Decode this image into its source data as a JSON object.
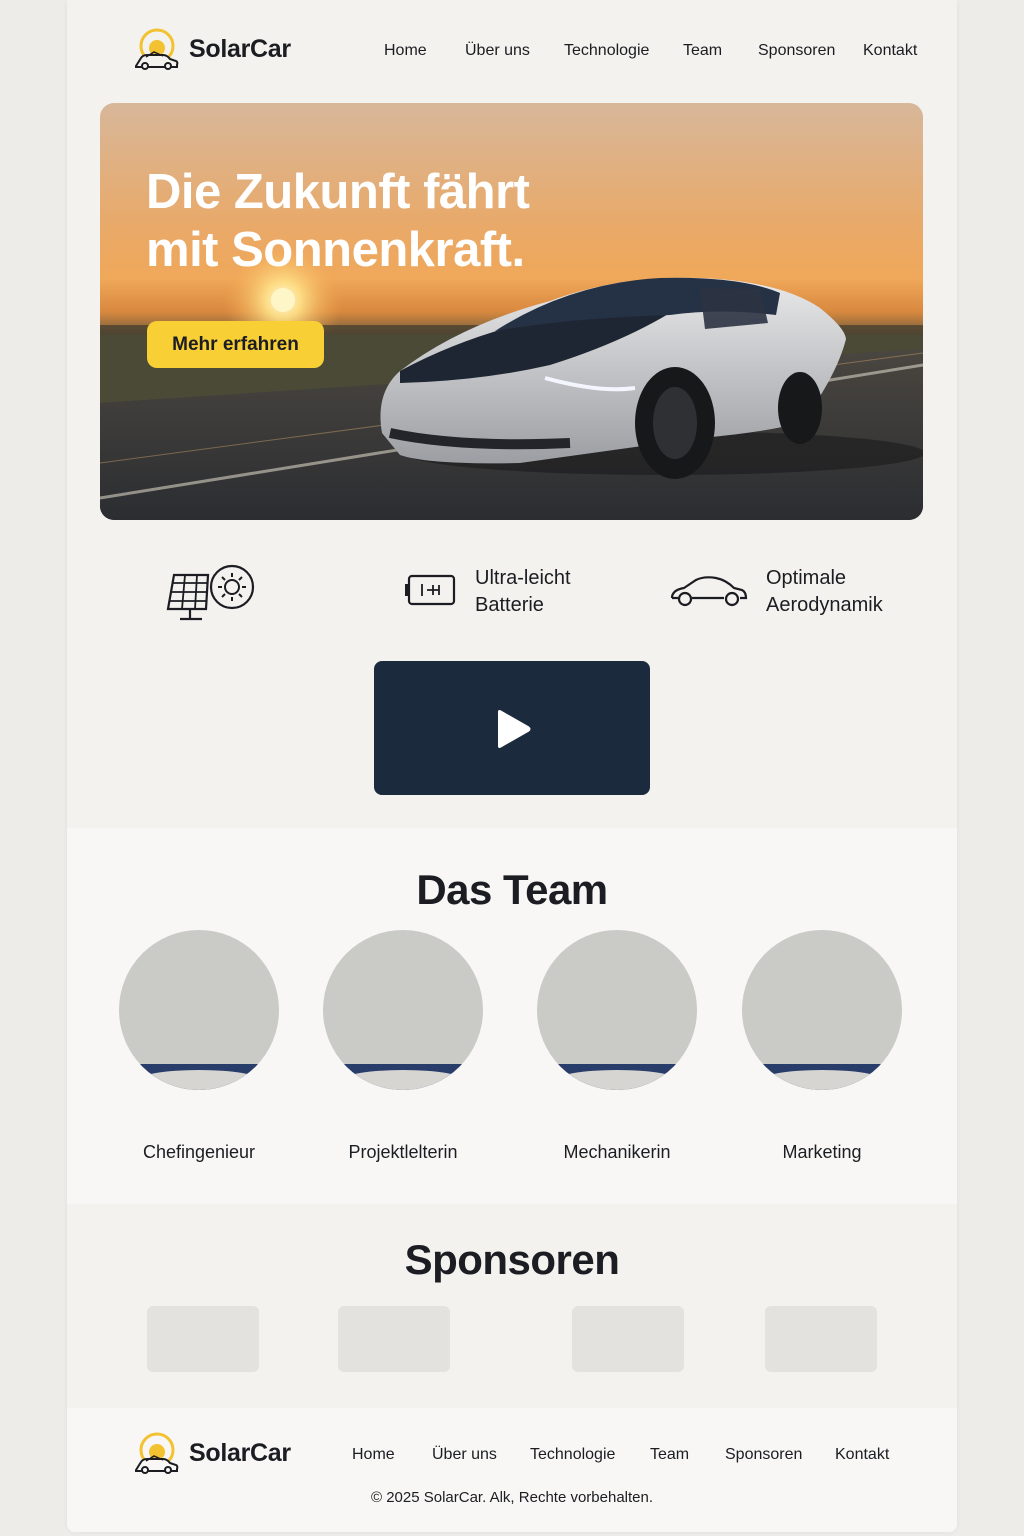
{
  "brand": {
    "name": "SolarCar",
    "logo_icon": "sun-car-logo-icon"
  },
  "nav": [
    "Home",
    "Über uns",
    "Technologie",
    "Team",
    "Sponsoren",
    "Kontakt"
  ],
  "hero": {
    "title_line1": "Die Zukunft fährt",
    "title_line2": "mit Sonnenkraft.",
    "cta_label": "Mehr erfahren"
  },
  "features": [
    {
      "icon": "solar-panel-sun-icon",
      "line1": "",
      "line2": ""
    },
    {
      "icon": "battery-icon",
      "line1": "Ultra-leicht",
      "line2": "Batterie"
    },
    {
      "icon": "car-outline-icon",
      "line1": "Optimale",
      "line2": "Aerodynamik"
    }
  ],
  "video": {
    "icon": "play-icon"
  },
  "team": {
    "title": "Das Team",
    "members": [
      {
        "role": "Chefingenieur"
      },
      {
        "role": "Projektlelterin"
      },
      {
        "role": "Mechanikerin"
      },
      {
        "role": "Marketing"
      }
    ]
  },
  "sponsors": {
    "title": "Sponsoren",
    "count": 4
  },
  "footer": {
    "nav": [
      "Home",
      "Über uns",
      "Technologie",
      "Team",
      "Sponsoren",
      "Kontakt"
    ],
    "copyright": "© 2025 SolarCar. Alk, Rechte vorbehalten."
  },
  "colors": {
    "accent": "#f8cf34",
    "video_bg": "#1c2a3d",
    "text": "#1b1d22"
  }
}
